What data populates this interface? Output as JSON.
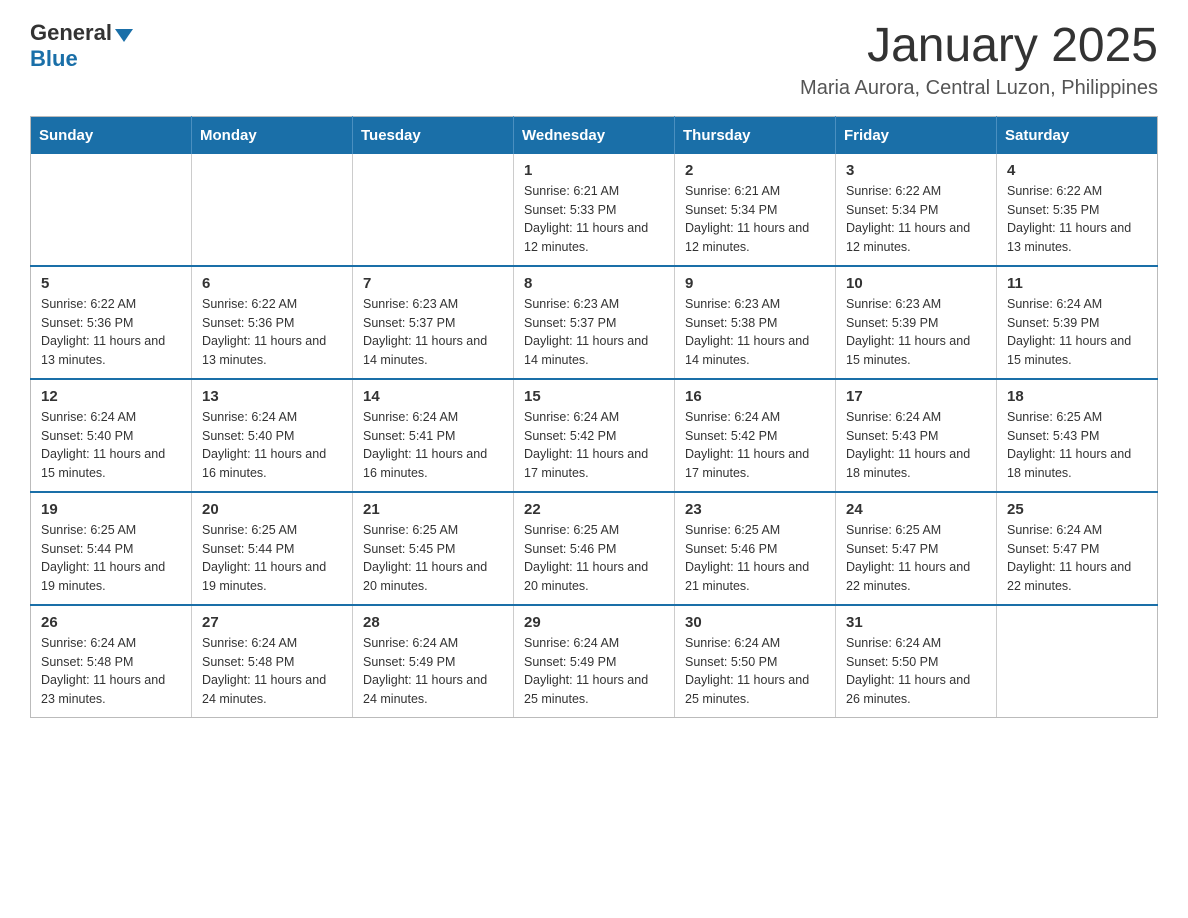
{
  "header": {
    "logo_general": "General",
    "logo_blue": "Blue",
    "month_title": "January 2025",
    "location": "Maria Aurora, Central Luzon, Philippines"
  },
  "weekdays": [
    "Sunday",
    "Monday",
    "Tuesday",
    "Wednesday",
    "Thursday",
    "Friday",
    "Saturday"
  ],
  "weeks": [
    [
      {
        "day": "",
        "info": ""
      },
      {
        "day": "",
        "info": ""
      },
      {
        "day": "",
        "info": ""
      },
      {
        "day": "1",
        "info": "Sunrise: 6:21 AM\nSunset: 5:33 PM\nDaylight: 11 hours and 12 minutes."
      },
      {
        "day": "2",
        "info": "Sunrise: 6:21 AM\nSunset: 5:34 PM\nDaylight: 11 hours and 12 minutes."
      },
      {
        "day": "3",
        "info": "Sunrise: 6:22 AM\nSunset: 5:34 PM\nDaylight: 11 hours and 12 minutes."
      },
      {
        "day": "4",
        "info": "Sunrise: 6:22 AM\nSunset: 5:35 PM\nDaylight: 11 hours and 13 minutes."
      }
    ],
    [
      {
        "day": "5",
        "info": "Sunrise: 6:22 AM\nSunset: 5:36 PM\nDaylight: 11 hours and 13 minutes."
      },
      {
        "day": "6",
        "info": "Sunrise: 6:22 AM\nSunset: 5:36 PM\nDaylight: 11 hours and 13 minutes."
      },
      {
        "day": "7",
        "info": "Sunrise: 6:23 AM\nSunset: 5:37 PM\nDaylight: 11 hours and 14 minutes."
      },
      {
        "day": "8",
        "info": "Sunrise: 6:23 AM\nSunset: 5:37 PM\nDaylight: 11 hours and 14 minutes."
      },
      {
        "day": "9",
        "info": "Sunrise: 6:23 AM\nSunset: 5:38 PM\nDaylight: 11 hours and 14 minutes."
      },
      {
        "day": "10",
        "info": "Sunrise: 6:23 AM\nSunset: 5:39 PM\nDaylight: 11 hours and 15 minutes."
      },
      {
        "day": "11",
        "info": "Sunrise: 6:24 AM\nSunset: 5:39 PM\nDaylight: 11 hours and 15 minutes."
      }
    ],
    [
      {
        "day": "12",
        "info": "Sunrise: 6:24 AM\nSunset: 5:40 PM\nDaylight: 11 hours and 15 minutes."
      },
      {
        "day": "13",
        "info": "Sunrise: 6:24 AM\nSunset: 5:40 PM\nDaylight: 11 hours and 16 minutes."
      },
      {
        "day": "14",
        "info": "Sunrise: 6:24 AM\nSunset: 5:41 PM\nDaylight: 11 hours and 16 minutes."
      },
      {
        "day": "15",
        "info": "Sunrise: 6:24 AM\nSunset: 5:42 PM\nDaylight: 11 hours and 17 minutes."
      },
      {
        "day": "16",
        "info": "Sunrise: 6:24 AM\nSunset: 5:42 PM\nDaylight: 11 hours and 17 minutes."
      },
      {
        "day": "17",
        "info": "Sunrise: 6:24 AM\nSunset: 5:43 PM\nDaylight: 11 hours and 18 minutes."
      },
      {
        "day": "18",
        "info": "Sunrise: 6:25 AM\nSunset: 5:43 PM\nDaylight: 11 hours and 18 minutes."
      }
    ],
    [
      {
        "day": "19",
        "info": "Sunrise: 6:25 AM\nSunset: 5:44 PM\nDaylight: 11 hours and 19 minutes."
      },
      {
        "day": "20",
        "info": "Sunrise: 6:25 AM\nSunset: 5:44 PM\nDaylight: 11 hours and 19 minutes."
      },
      {
        "day": "21",
        "info": "Sunrise: 6:25 AM\nSunset: 5:45 PM\nDaylight: 11 hours and 20 minutes."
      },
      {
        "day": "22",
        "info": "Sunrise: 6:25 AM\nSunset: 5:46 PM\nDaylight: 11 hours and 20 minutes."
      },
      {
        "day": "23",
        "info": "Sunrise: 6:25 AM\nSunset: 5:46 PM\nDaylight: 11 hours and 21 minutes."
      },
      {
        "day": "24",
        "info": "Sunrise: 6:25 AM\nSunset: 5:47 PM\nDaylight: 11 hours and 22 minutes."
      },
      {
        "day": "25",
        "info": "Sunrise: 6:24 AM\nSunset: 5:47 PM\nDaylight: 11 hours and 22 minutes."
      }
    ],
    [
      {
        "day": "26",
        "info": "Sunrise: 6:24 AM\nSunset: 5:48 PM\nDaylight: 11 hours and 23 minutes."
      },
      {
        "day": "27",
        "info": "Sunrise: 6:24 AM\nSunset: 5:48 PM\nDaylight: 11 hours and 24 minutes."
      },
      {
        "day": "28",
        "info": "Sunrise: 6:24 AM\nSunset: 5:49 PM\nDaylight: 11 hours and 24 minutes."
      },
      {
        "day": "29",
        "info": "Sunrise: 6:24 AM\nSunset: 5:49 PM\nDaylight: 11 hours and 25 minutes."
      },
      {
        "day": "30",
        "info": "Sunrise: 6:24 AM\nSunset: 5:50 PM\nDaylight: 11 hours and 25 minutes."
      },
      {
        "day": "31",
        "info": "Sunrise: 6:24 AM\nSunset: 5:50 PM\nDaylight: 11 hours and 26 minutes."
      },
      {
        "day": "",
        "info": ""
      }
    ]
  ]
}
